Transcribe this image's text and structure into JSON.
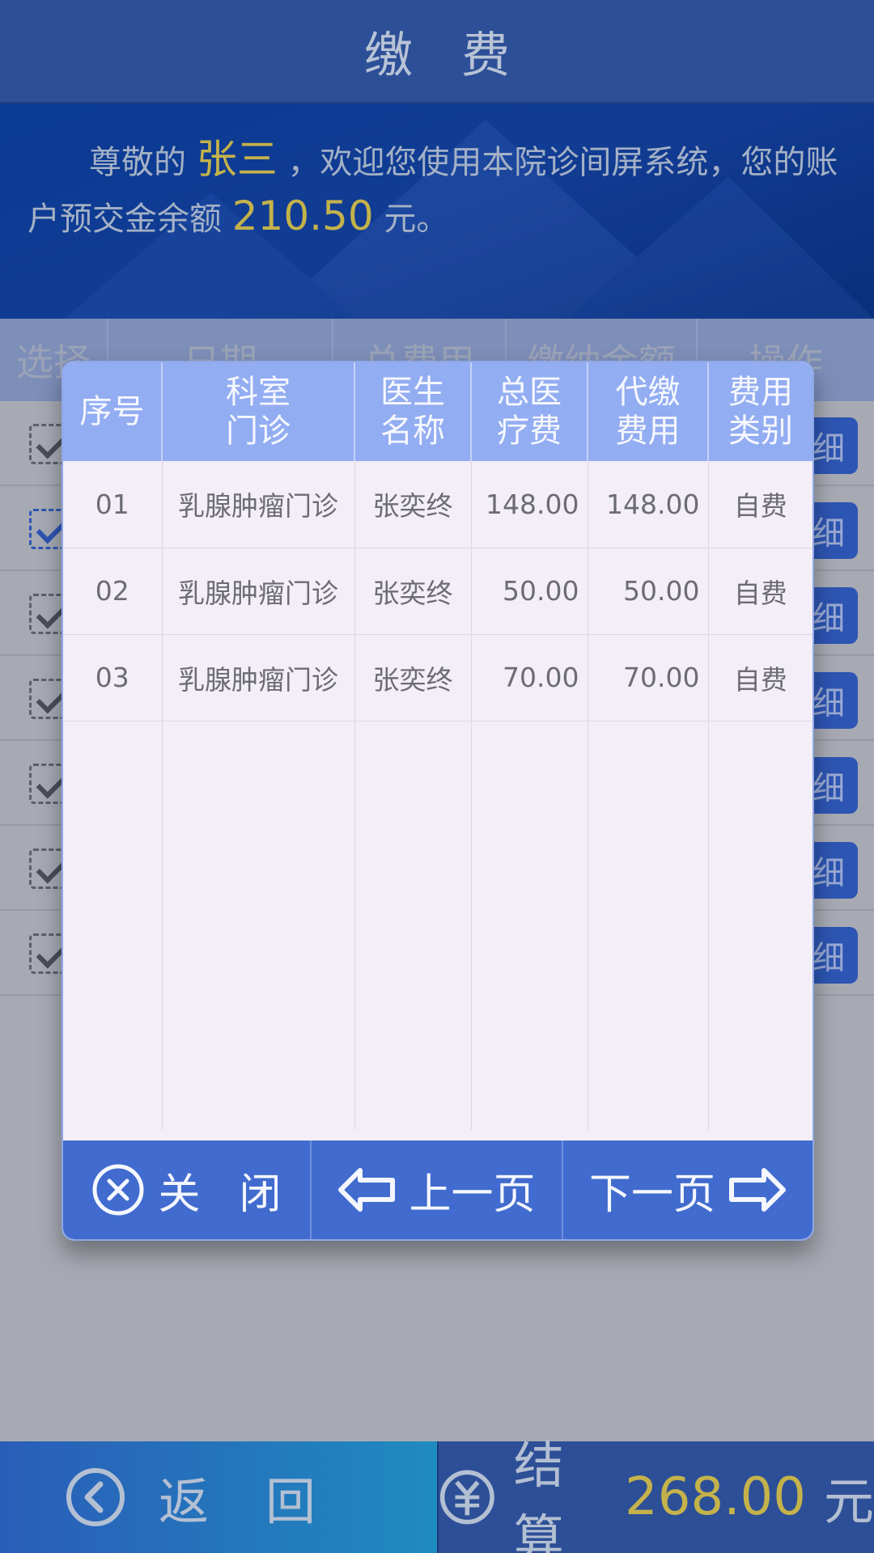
{
  "header": {
    "title": "缴费"
  },
  "welcome": {
    "prefix": "尊敬的",
    "name": "张三",
    "mid": "，欢迎您使用本院诊间屏系统，您的账户预交金余额",
    "balance": "210.50",
    "suffix": "元。"
  },
  "list": {
    "columns": [
      "选择",
      "日期",
      "总费用",
      "缴纳金额",
      "操作"
    ],
    "detail_label": "细",
    "rows": [
      {
        "checked": true,
        "highlight": false
      },
      {
        "checked": true,
        "highlight": true
      },
      {
        "checked": true,
        "highlight": false
      },
      {
        "checked": true,
        "highlight": false
      },
      {
        "checked": true,
        "highlight": false
      },
      {
        "checked": true,
        "highlight": false
      },
      {
        "checked": true,
        "highlight": false
      }
    ]
  },
  "modal": {
    "headers": [
      "序号",
      "科室\n门诊",
      "医生\n名称",
      "总医\n疗费",
      "代缴\n费用",
      "费用\n类别"
    ],
    "rows": [
      {
        "no": "01",
        "dept": "乳腺肿瘤门诊",
        "doctor": "张奕终",
        "total": "148.00",
        "paid": "148.00",
        "type": "自费"
      },
      {
        "no": "02",
        "dept": "乳腺肿瘤门诊",
        "doctor": "张奕终",
        "total": "50.00",
        "paid": "50.00",
        "type": "自费"
      },
      {
        "no": "03",
        "dept": "乳腺肿瘤门诊",
        "doctor": "张奕终",
        "total": "70.00",
        "paid": "70.00",
        "type": "自费"
      }
    ],
    "close_label": "关闭",
    "prev_label": "上一页",
    "next_label": "下一页"
  },
  "footer": {
    "back_label": "返回",
    "settle_label": "结算",
    "settle_amount": "268.00",
    "settle_unit": "元"
  },
  "colors": {
    "accent": "#c4b24b",
    "primary": "#416bce",
    "header_bg": "#2d4f97"
  }
}
